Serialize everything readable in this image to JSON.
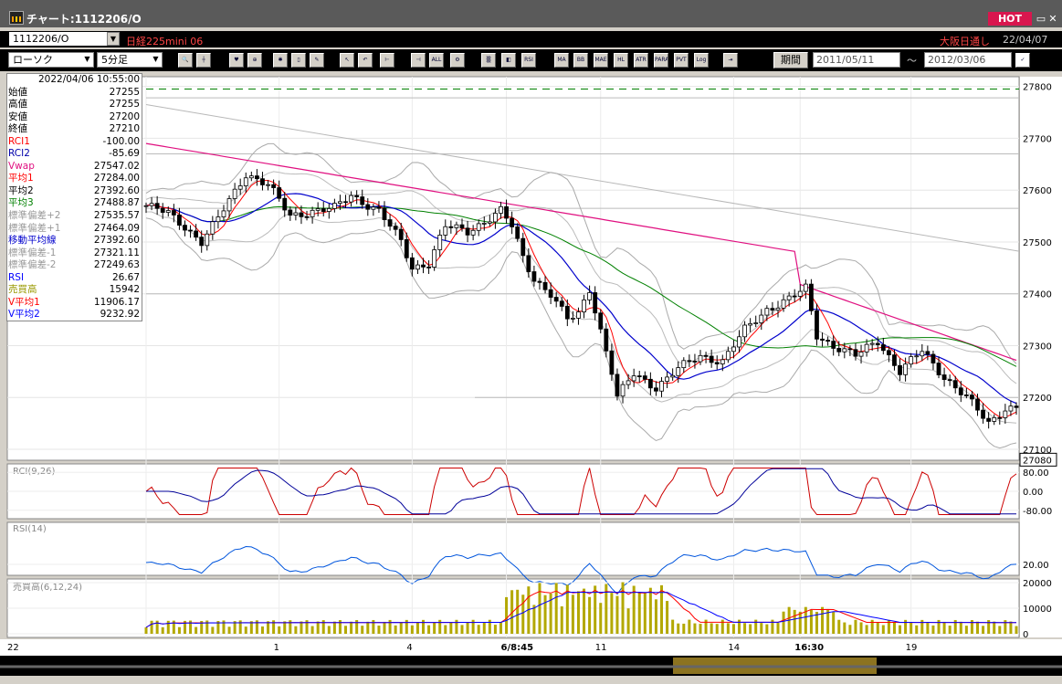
{
  "window": {
    "title": "チャート:1112206/O",
    "hot_label": "HOT",
    "min_glyph": "▭",
    "close_glyph": "✕"
  },
  "symbol_bar": {
    "code": "1112206/O",
    "name": "日経225mini 06",
    "session": "大阪日通し",
    "date": "22/04/07"
  },
  "toolbar": {
    "chart_type": "ローソク",
    "timeframe": "5分足",
    "period_label": "期間",
    "date_from": "2011/05/11",
    "date_to": "2012/03/06",
    "range_sep": "〜",
    "icons": [
      {
        "name": "zoom-icon",
        "glyph": "🔍"
      },
      {
        "name": "crosshair-icon",
        "glyph": "┼"
      },
      {
        "name": "candle-mark-icon",
        "glyph": "♥"
      },
      {
        "name": "zoom-area-icon",
        "glyph": "⊕"
      },
      {
        "name": "candle-color-icon",
        "glyph": "✱"
      },
      {
        "name": "scale-icon",
        "glyph": "▯"
      },
      {
        "name": "pencil-icon",
        "glyph": "✎"
      },
      {
        "name": "cursor-icon",
        "glyph": "↖"
      },
      {
        "name": "undo-icon",
        "glyph": "↶"
      },
      {
        "name": "candle-add-icon",
        "glyph": "⊢"
      },
      {
        "name": "candle-remove-icon",
        "glyph": "⊣"
      },
      {
        "name": "all-icon",
        "glyph": "ALL"
      },
      {
        "name": "settings-icon",
        "glyph": "⚙"
      },
      {
        "name": "color-icon",
        "glyph": "▒"
      },
      {
        "name": "palette-icon",
        "glyph": "◧"
      },
      {
        "name": "rsi-icon",
        "glyph": "RSI"
      },
      {
        "name": "ma-icon",
        "glyph": "MA"
      },
      {
        "name": "bb-icon",
        "glyph": "BB"
      },
      {
        "name": "mae-icon",
        "glyph": "MAE"
      },
      {
        "name": "hl-icon",
        "glyph": "HL"
      },
      {
        "name": "atr-icon",
        "glyph": "ATR"
      },
      {
        "name": "para-icon",
        "glyph": "PARA"
      },
      {
        "name": "pvt-icon",
        "glyph": "PVT"
      },
      {
        "name": "log-icon",
        "glyph": "Log"
      },
      {
        "name": "export-icon",
        "glyph": "⇥"
      }
    ]
  },
  "info_panel": {
    "timestamp": "2022/04/06  10:55:00",
    "rows": [
      {
        "label": "始値",
        "value": "27255",
        "color": "#000000"
      },
      {
        "label": "高値",
        "value": "27255",
        "color": "#000000"
      },
      {
        "label": "安値",
        "value": "27200",
        "color": "#000000"
      },
      {
        "label": "終値",
        "value": "27210",
        "color": "#000000"
      },
      {
        "label": "RCI1",
        "value": "-100.00",
        "color": "#ff0000"
      },
      {
        "label": "RCI2",
        "value": "-85.69",
        "color": "#0000aa"
      },
      {
        "label": "Vwap",
        "value": "27547.02",
        "color": "#e01080"
      },
      {
        "label": "平均1",
        "value": "27284.00",
        "color": "#ff0000"
      },
      {
        "label": "平均2",
        "value": "27392.60",
        "color": "#000000"
      },
      {
        "label": "平均3",
        "value": "27488.87",
        "color": "#008000"
      },
      {
        "label": "標準偏差+2",
        "value": "27535.57",
        "color": "#999999"
      },
      {
        "label": "標準偏差+1",
        "value": "27464.09",
        "color": "#999999"
      },
      {
        "label": "移動平均線",
        "value": "27392.60",
        "color": "#0000cc"
      },
      {
        "label": "標準偏差-1",
        "value": "27321.11",
        "color": "#999999"
      },
      {
        "label": "標準偏差-2",
        "value": "27249.63",
        "color": "#999999"
      },
      {
        "label": "RSI",
        "value": "26.67",
        "color": "#0000ff"
      },
      {
        "label": "売買高",
        "value": "15942",
        "color": "#999900"
      },
      {
        "label": "V平均1",
        "value": "11906.17",
        "color": "#ff0000"
      },
      {
        "label": "V平均2",
        "value": "9232.92",
        "color": "#0000ff"
      }
    ]
  },
  "chart_data": [
    {
      "type": "candlestick",
      "y_ticks": [
        "27800",
        "27700",
        "27600",
        "27500",
        "27400",
        "27300",
        "27200",
        "27100"
      ],
      "ylim": [
        27100,
        27810
      ],
      "current_price": "27080",
      "x_labels": [
        {
          "text": "22",
          "idx": 0
        },
        {
          "text": "1",
          "idx": 24
        },
        {
          "text": "4",
          "idx": 48
        },
        {
          "text": "6/8:45",
          "idx": 65
        },
        {
          "text": "11",
          "idx": 82
        },
        {
          "text": "14",
          "idx": 106
        },
        {
          "text": "16:30",
          "idx": 118
        },
        {
          "text": "19",
          "idx": 138
        }
      ],
      "bars": 158,
      "anchors": [
        [
          0,
          27570
        ],
        [
          4,
          27555
        ],
        [
          7,
          27530
        ],
        [
          10,
          27500
        ],
        [
          13,
          27545
        ],
        [
          18,
          27632
        ],
        [
          22,
          27610
        ],
        [
          26,
          27550
        ],
        [
          30,
          27560
        ],
        [
          34,
          27565
        ],
        [
          37,
          27590
        ],
        [
          42,
          27560
        ],
        [
          46,
          27500
        ],
        [
          48,
          27450
        ],
        [
          51,
          27460
        ],
        [
          54,
          27530
        ],
        [
          58,
          27520
        ],
        [
          61,
          27540
        ],
        [
          64,
          27560
        ],
        [
          66,
          27530
        ],
        [
          68,
          27470
        ],
        [
          70,
          27430
        ],
        [
          73,
          27400
        ],
        [
          76,
          27350
        ],
        [
          78,
          27360
        ],
        [
          80,
          27410
        ],
        [
          82,
          27330
        ],
        [
          84,
          27250
        ],
        [
          85,
          27200
        ],
        [
          88,
          27245
        ],
        [
          92,
          27220
        ],
        [
          96,
          27255
        ],
        [
          100,
          27280
        ],
        [
          104,
          27270
        ],
        [
          108,
          27330
        ],
        [
          112,
          27370
        ],
        [
          116,
          27390
        ],
        [
          119,
          27410
        ],
        [
          121,
          27320
        ],
        [
          124,
          27300
        ],
        [
          128,
          27280
        ],
        [
          132,
          27310
        ],
        [
          136,
          27250
        ],
        [
          140,
          27290
        ],
        [
          144,
          27240
        ],
        [
          148,
          27200
        ],
        [
          152,
          27150
        ],
        [
          155,
          27180
        ],
        [
          157,
          27180
        ]
      ]
    },
    {
      "type": "line",
      "title": "RCI(9,26)",
      "y_ticks": [
        "80.00",
        "0.00",
        "-80.00"
      ],
      "ylim": [
        -100,
        100
      ]
    },
    {
      "type": "line",
      "title": "RSI(14)",
      "y_ticks": [
        "20.00"
      ]
    },
    {
      "type": "bar",
      "title": "売買高(6,12,24)",
      "y_ticks": [
        "20000",
        "10000",
        "0"
      ],
      "ylim": [
        0,
        20000
      ]
    }
  ]
}
